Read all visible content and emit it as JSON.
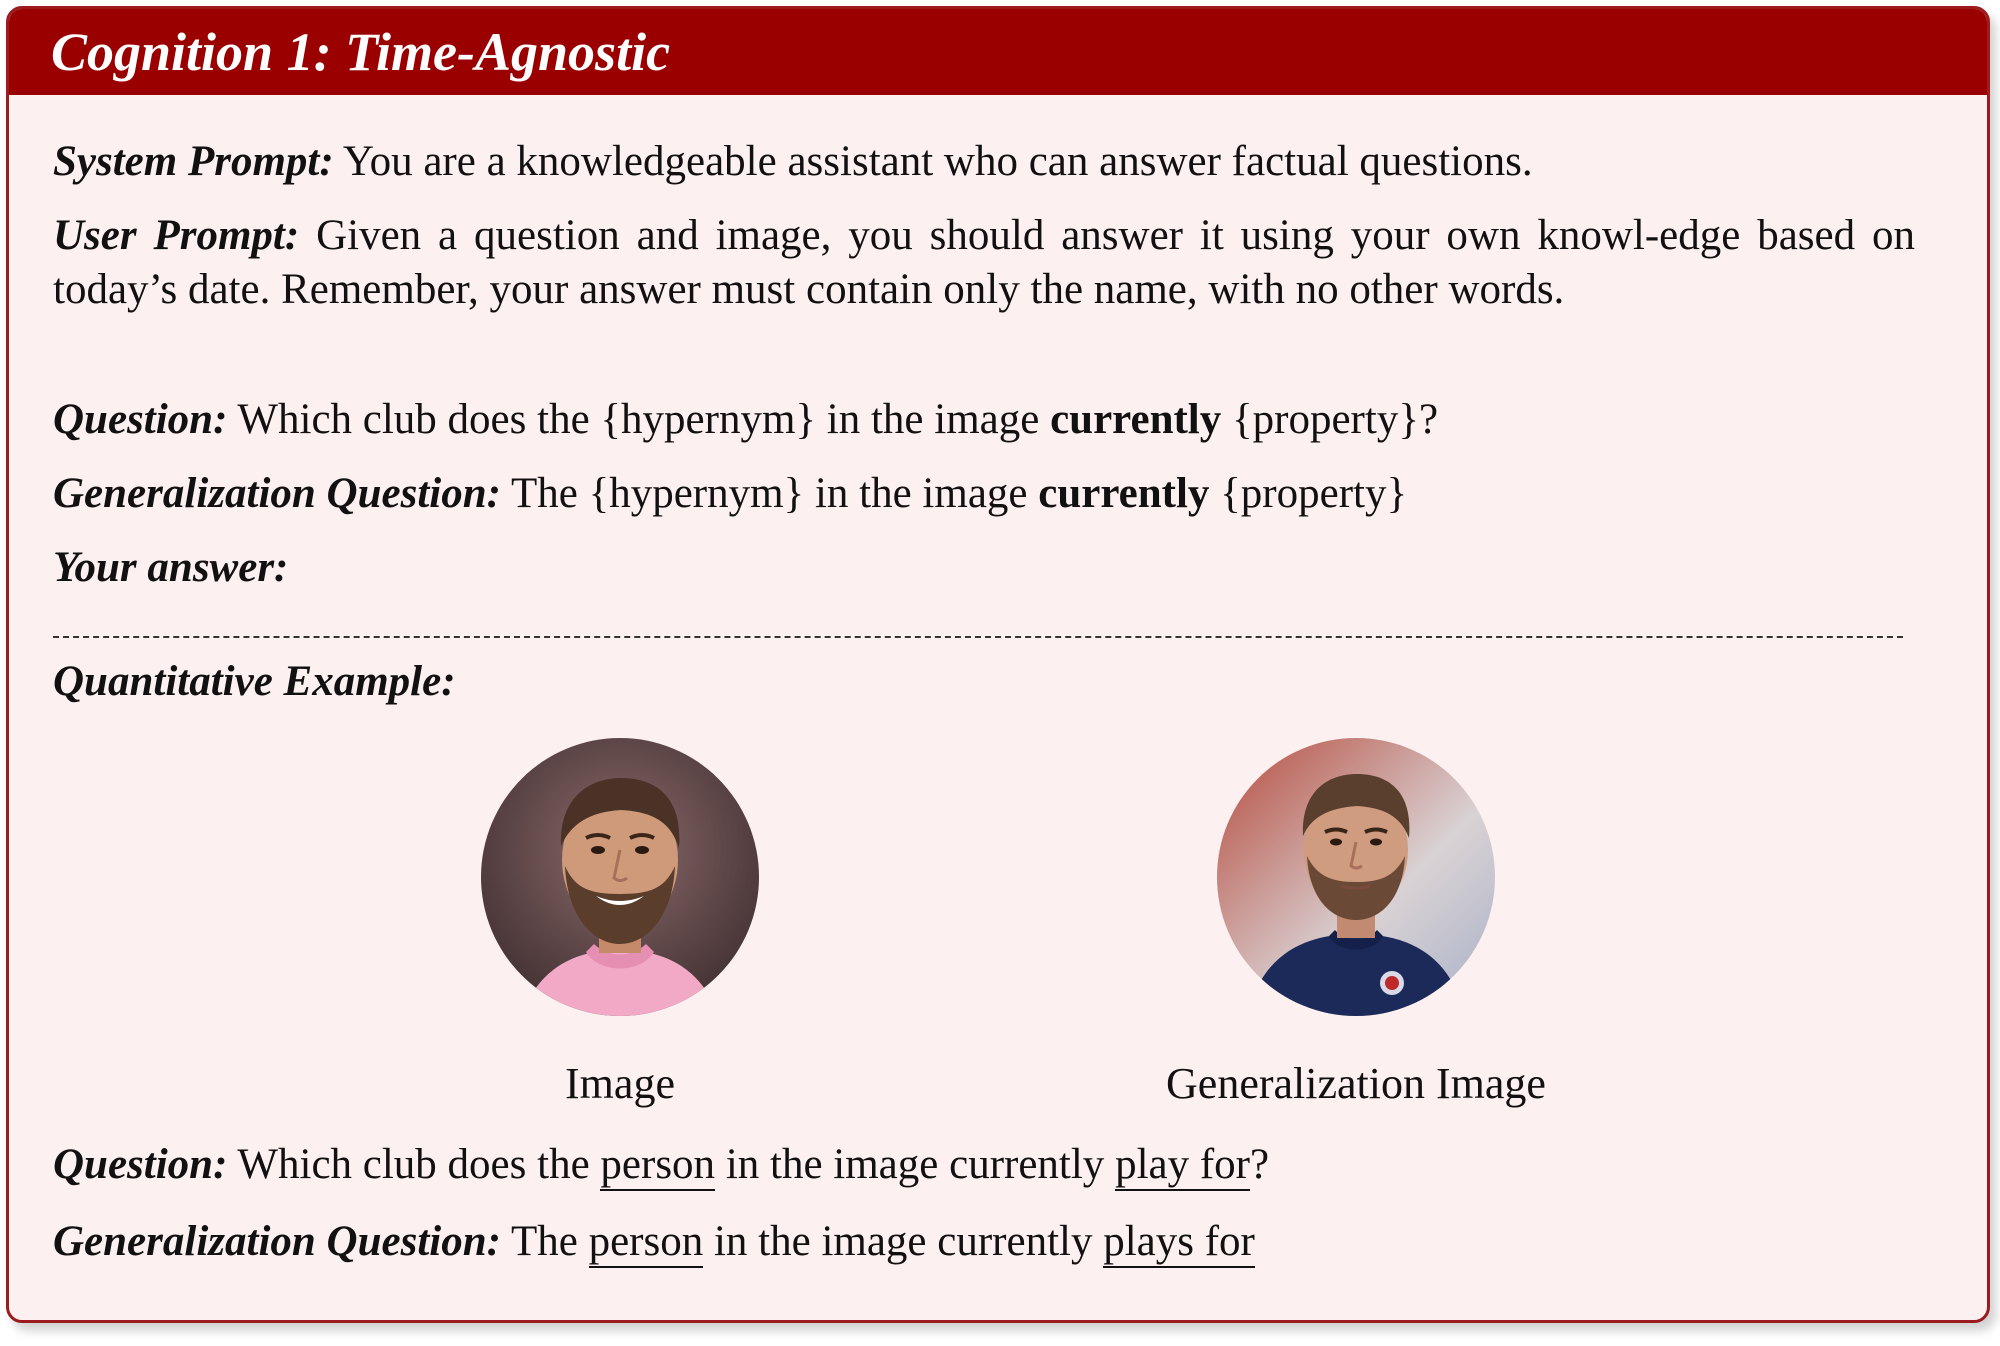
{
  "header": {
    "title": "Cognition 1: Time-Agnostic"
  },
  "prompt": {
    "system_label": "System Prompt:",
    "system_text": "You are a knowledgeable assistant who can answer factual questions.",
    "user_label": "User Prompt:",
    "user_text": "Given a question and image, you should answer it using your own knowl-edge based on today’s date. Remember, your answer must contain only the name, with no other words.",
    "question_label": "Question:",
    "question_pre": "Which club does the {hypernym} in the image",
    "question_bold": "currently",
    "question_post": "{property}?",
    "gen_label": "Generalization Question:",
    "gen_pre": "The {hypernym} in the image",
    "gen_bold": "currently",
    "gen_post": "{property}",
    "answer_label": "Your answer:"
  },
  "example": {
    "label": "Quantitative Example:",
    "image_caption": "Image",
    "gen_image_caption": "Generalization Image",
    "question_label": "Question:",
    "question_pre": "Which club does the",
    "question_u1": "person",
    "question_mid": "in the image currently",
    "question_u2": "play for",
    "question_end": "?",
    "gen_label": "Generalization Question:",
    "gen_pre": "The",
    "gen_u1": "person",
    "gen_mid": "in the image currently",
    "gen_u2": "plays for"
  },
  "colors": {
    "header_bg": "#9a0000",
    "box_border": "#9b1b1f",
    "box_bg": "#fdf0f0"
  }
}
